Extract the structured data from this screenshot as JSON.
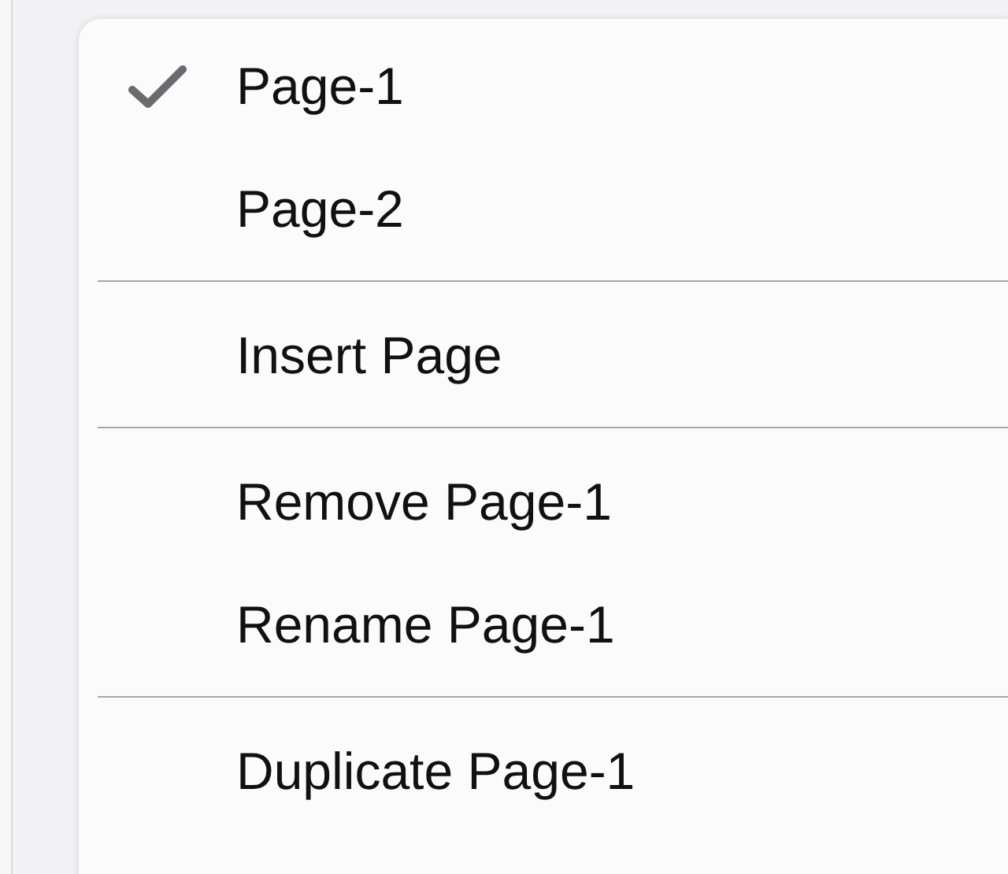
{
  "menu": {
    "items": [
      {
        "kind": "item",
        "label": "Page-1",
        "checked": true
      },
      {
        "kind": "item",
        "label": "Page-2",
        "checked": false
      },
      {
        "kind": "separator"
      },
      {
        "kind": "item",
        "label": "Insert Page",
        "checked": false
      },
      {
        "kind": "separator"
      },
      {
        "kind": "item",
        "label": "Remove Page-1",
        "checked": false
      },
      {
        "kind": "item",
        "label": "Rename Page-1",
        "checked": false
      },
      {
        "kind": "separator"
      },
      {
        "kind": "item",
        "label": "Duplicate Page-1",
        "checked": false
      }
    ]
  }
}
